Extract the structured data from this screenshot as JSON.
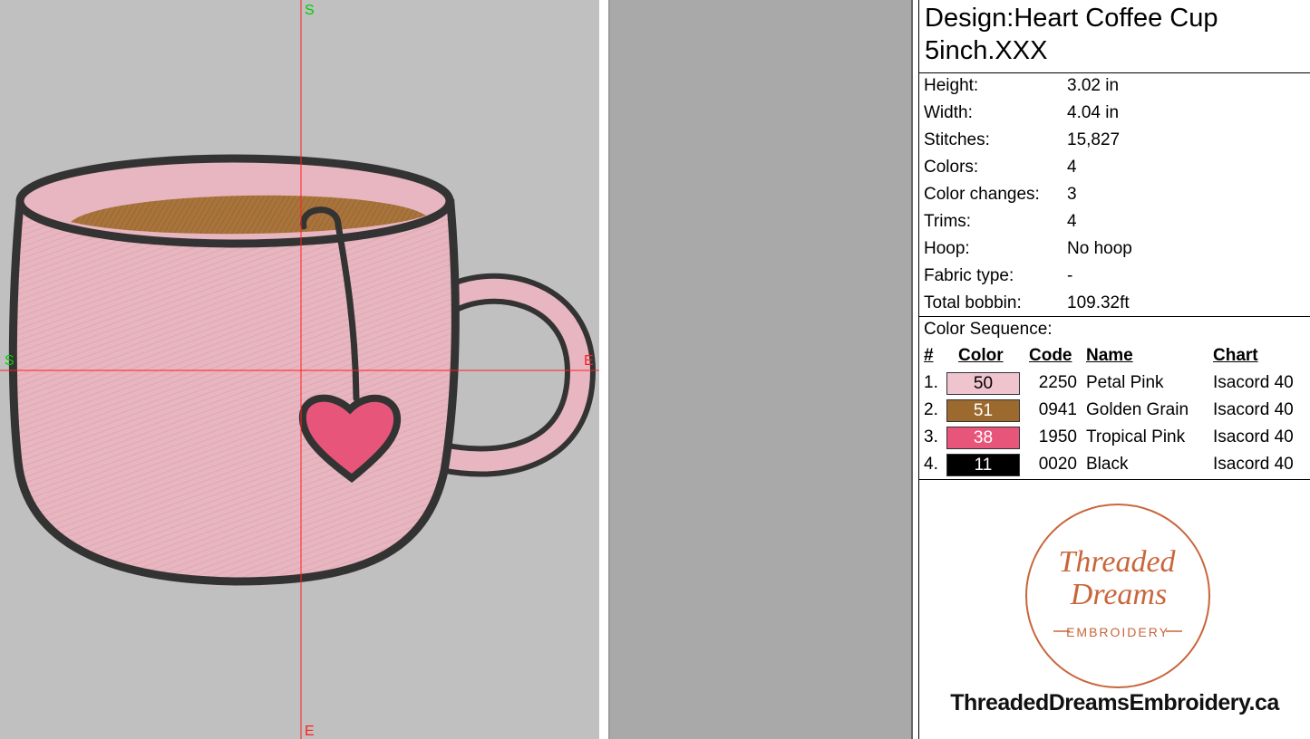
{
  "canvas": {
    "axis_labels": {
      "top": "S",
      "bottom": "E",
      "left": "S",
      "right": "E"
    },
    "colors": {
      "background": "#c0c0c0",
      "crosshair": "#ff2020",
      "start_marker": "#00cc00",
      "cup_fill": "#e8b6c0",
      "outline": "#333333",
      "coffee": "#a8743c",
      "heart": "#e8557a"
    }
  },
  "panel": {
    "design_label": "Design:Heart Coffee Cup",
    "design_file": "5inch.XXX",
    "properties": [
      {
        "label": "Height:",
        "value": "3.02 in"
      },
      {
        "label": "Width:",
        "value": "4.04 in"
      },
      {
        "label": "Stitches:",
        "value": "15,827"
      },
      {
        "label": "Colors:",
        "value": "4"
      },
      {
        "label": "Color changes:",
        "value": "3"
      },
      {
        "label": "Trims:",
        "value": "4"
      },
      {
        "label": "Hoop:",
        "value": "No hoop"
      },
      {
        "label": "Fabric type:",
        "value": "-"
      },
      {
        "label": "Total bobbin:",
        "value": "109.32ft"
      }
    ],
    "sequence_title": "Color Sequence:",
    "table_headers": {
      "num": "#",
      "color": "Color",
      "code": "Code",
      "name": "Name",
      "chart": "Chart"
    },
    "colors": [
      {
        "num": "1.",
        "swatch_label": "50",
        "swatch_color": "#f0c4cf",
        "text_color": "#000000",
        "code": "2250",
        "name": "Petal Pink",
        "chart": "Isacord 40"
      },
      {
        "num": "2.",
        "swatch_label": "51",
        "swatch_color": "#9c6a2e",
        "text_color": "#ffffff",
        "code": "0941",
        "name": "Golden Grain",
        "chart": "Isacord 40"
      },
      {
        "num": "3.",
        "swatch_label": "38",
        "swatch_color": "#e8557a",
        "text_color": "#ffffff",
        "code": "1950",
        "name": "Tropical Pink",
        "chart": "Isacord 40"
      },
      {
        "num": "4.",
        "swatch_label": "11",
        "swatch_color": "#000000",
        "text_color": "#ffffff",
        "code": "0020",
        "name": "Black",
        "chart": "Isacord 40"
      }
    ],
    "logo": {
      "line1": "Threaded",
      "line2": "Dreams",
      "line3": "EMBROIDERY",
      "color": "#c8663c"
    },
    "website": "ThreadedDreamsEmbroidery.ca"
  }
}
